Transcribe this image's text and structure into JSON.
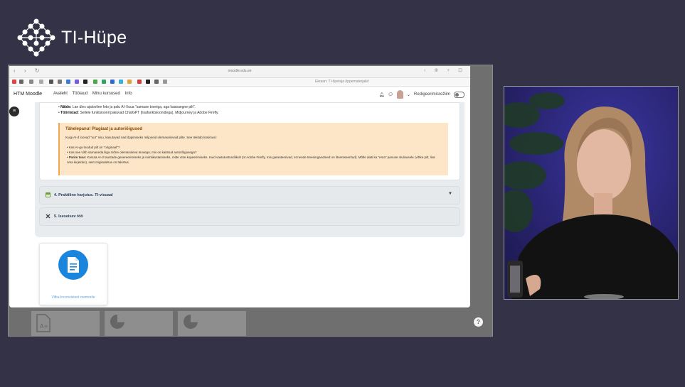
{
  "stream": {
    "brand_name": "TI-Hüpe"
  },
  "browser": {
    "url": "moodle.edu.ee",
    "tab_label": "Ekraan: TI-õpetaja õppematerjalid",
    "nav_buttons": "‹ › ↻",
    "right_icons": "‹ ⊕ + ⊡"
  },
  "moodle": {
    "brand": "HTM Moodle",
    "menu": [
      "Avaleht",
      "Töölaud",
      "Minu kursused",
      "Info"
    ],
    "edit_mode_label": "Redigeerimisrežiim",
    "bullet1_label": "Näide:",
    "bullet1_text": " Lae üles ajalooline foto ja palu AI-l luua \"samase tooniga, aga kaasaegne pilt\".",
    "bullet2_label": "Tööriistad:",
    "bullet2_text": " Sellele funktsioonil pakuvad ChatGPT (lisafunktsioonidega), Midjourney ja Adobe Firefly.",
    "warning_title": "Tähelepanu! Plagiaat ja autoriõigused",
    "warning_intro": "Kuigi AI-d loovad \"uut\" sisu, kasutavad nad õppimiseks miljoneid olemasolevaid pilte. See tekitab küsimusi:",
    "warning_items": [
      {
        "label": "",
        "text": "Kas AI-ga loodud pilt on \"originaal\"?"
      },
      {
        "label": "",
        "text": "Kas see võib sarnaneda liiga mõne olemasoleva teosega, mis on kaitstud autoriõigusega?"
      },
      {
        "label": "Parim tava:",
        "text": " Kasuta AI-d taustade genereerimiseks ja inimlikustamiseks, mitte otse kopeerimiseks. Kuid vastutustundlikult (nt Adobe Firefly, mis garanteerivad, et nende treeningandmed on litsentseeritud). Mõtle alati ka \"ema\" panuse olulisusele (võtke pilt, lisa oma kirjeldus), sest originaalsus on takistus."
      }
    ],
    "section4_label": "4. Praktiline harjutus. TI-visuaal",
    "section5_label": "5. Iseseisev töö",
    "tile_label": "Vilba Inconsistent memorile",
    "help_label": "?"
  },
  "colors": {
    "background": "#333246",
    "warning_bg": "#fde5c7",
    "accent_blue": "#1985dc"
  }
}
